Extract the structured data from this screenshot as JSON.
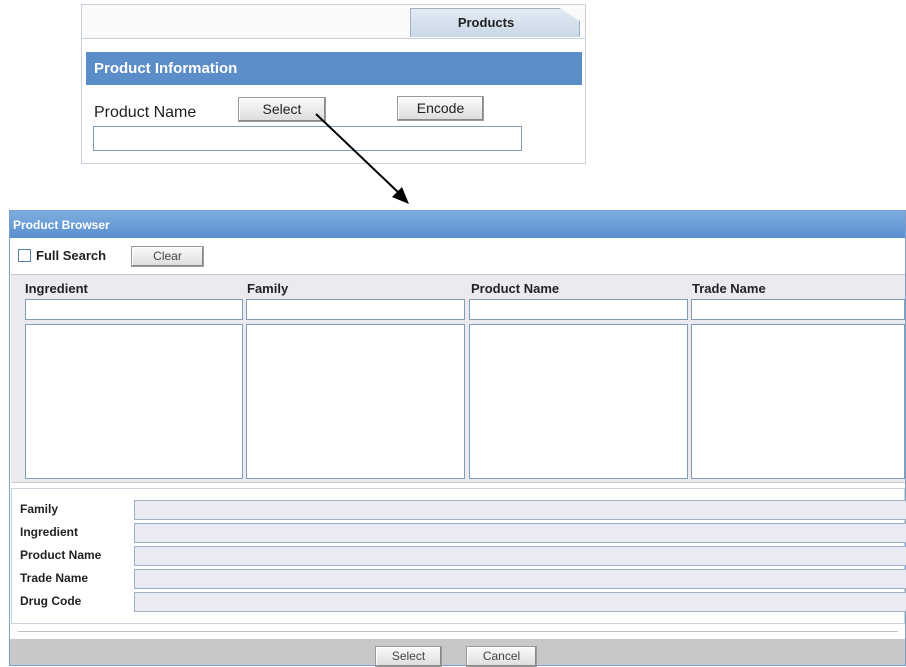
{
  "top_form": {
    "tab_label": "Products",
    "section_title": "Product Information",
    "product_name_label": "Product Name",
    "select_button": "Select",
    "encode_button": "Encode",
    "product_name_value": ""
  },
  "dialog": {
    "title": "Product Browser",
    "full_search_label": "Full Search",
    "full_search_checked": false,
    "clear_button": "Clear",
    "columns": [
      {
        "header": "Ingredient"
      },
      {
        "header": "Family"
      },
      {
        "header": "Product Name"
      },
      {
        "header": "Trade Name"
      }
    ],
    "details": [
      {
        "label": "Family",
        "value": ""
      },
      {
        "label": "Ingredient",
        "value": ""
      },
      {
        "label": "Product Name",
        "value": ""
      },
      {
        "label": "Trade Name",
        "value": ""
      },
      {
        "label": "Drug Code",
        "value": ""
      }
    ],
    "select_button": "Select",
    "cancel_button": "Cancel"
  },
  "colors": {
    "section_header": "#5b8dc8",
    "dialog_title": "#6b9dd6",
    "grid_background": "#ece9ef",
    "footer_bar": "#c8c8c8",
    "arrow": "#000000"
  }
}
